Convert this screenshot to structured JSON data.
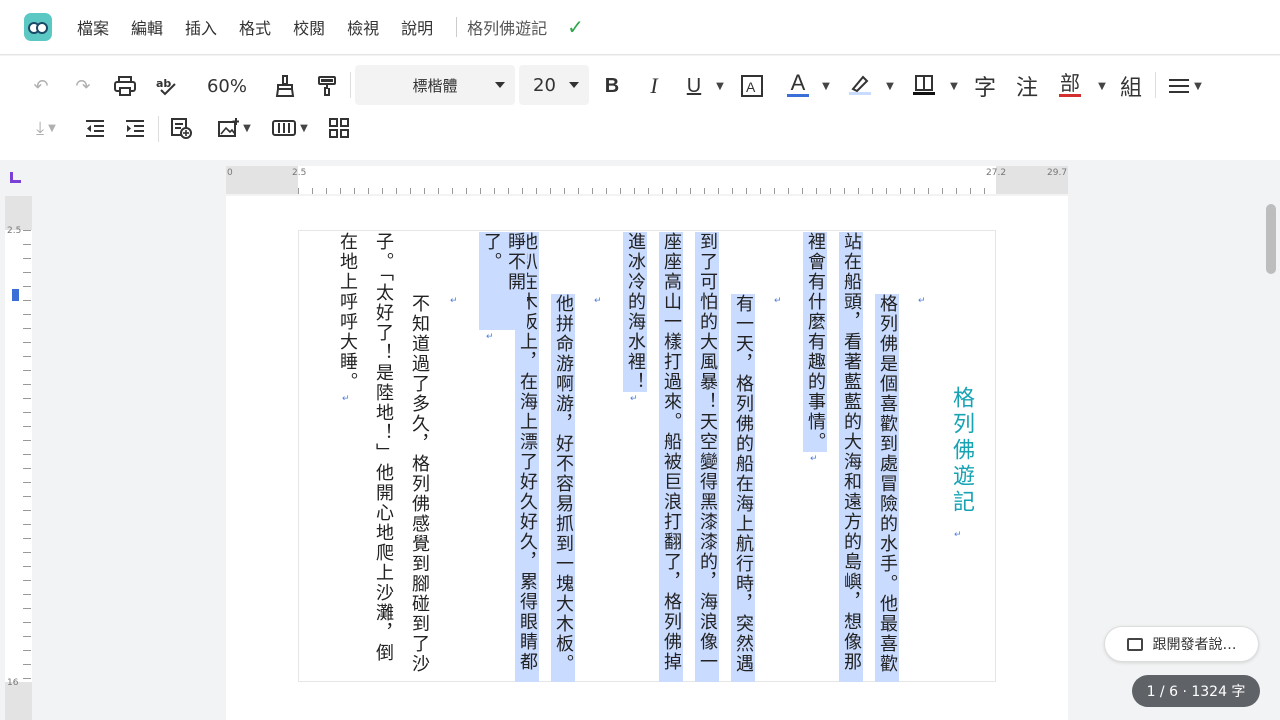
{
  "menubar": {
    "items": [
      "檔案",
      "編輯",
      "插入",
      "格式",
      "校閱",
      "檢視",
      "說明"
    ],
    "doc_title": "格列佛遊記",
    "saved_icon": "check-icon"
  },
  "toolbar": {
    "zoom": "60%",
    "font": "標楷體",
    "font_size": "20",
    "bold": "B",
    "italic": "I",
    "underline": "U",
    "font_color": "A",
    "char_btn": "字",
    "annot_btn": "注",
    "radical_btn": "部",
    "compose_btn": "組",
    "accent_font_color": "#3b6fd8",
    "accent_radical_color": "#d32f2f"
  },
  "ruler": {
    "top_labels": [
      "0",
      "2.5",
      "27.2",
      "29.7"
    ],
    "left_labels": [
      "2.5",
      "16"
    ]
  },
  "document": {
    "title": "格列佛遊記",
    "columns": [
      "格列佛是個喜歡到處冒險的水手。他最喜歡",
      "站在船頭，看著藍藍的大海和遠方的島嶼，想像那",
      "裡會有什麼有趣的事情。",
      "有一天，格列佛的船在海上航行時，突然遇",
      "到了可怕的大風暴！天空變得黑漆漆的，海浪像一",
      "座座高山一樣打過來。船被巨浪打翻了，格列佛掉",
      "進冰冷的海水裡！",
      "他拼命游啊游，好不容易抓到一塊大木板。",
      "他趴在木板上，在海上漂了好久好久，累得眼睛都",
      "睜不開了。",
      "不知道過了多久，格列佛感覺到腳碰到了沙",
      "子。「太好了！是陸地！」他開心地爬上沙灘，倒",
      "在地上呼呼大睡。"
    ]
  },
  "chat_button": "跟開發者說…",
  "status": "1 / 6 · 1324 字"
}
